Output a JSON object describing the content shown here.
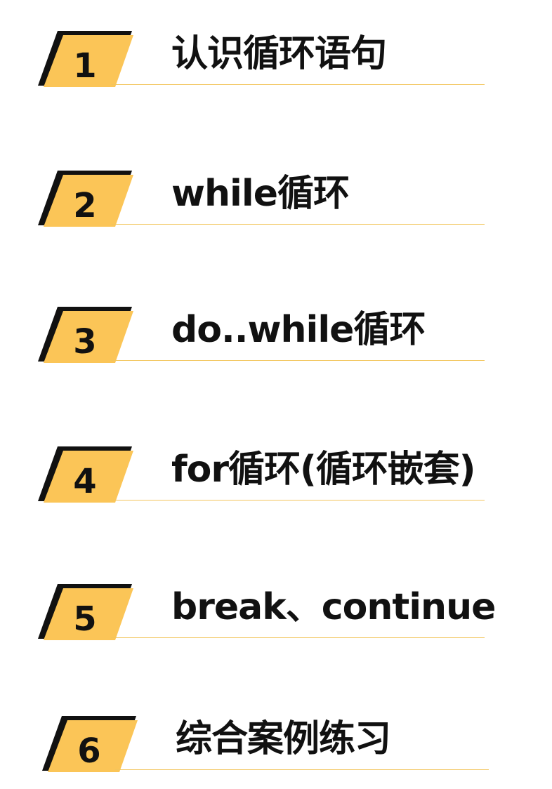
{
  "accent_color": "#fbc557",
  "stripe_color": "#111111",
  "line_color": "#f2c55c",
  "toc": [
    {
      "number": "1",
      "title": "认识循环语句"
    },
    {
      "number": "2",
      "title": "while循环"
    },
    {
      "number": "3",
      "title": "do..while循环"
    },
    {
      "number": "4",
      "title": "for循环(循环嵌套)"
    },
    {
      "number": "5",
      "title": "break、continue"
    },
    {
      "number": "6",
      "title": "综合案例练习"
    }
  ]
}
